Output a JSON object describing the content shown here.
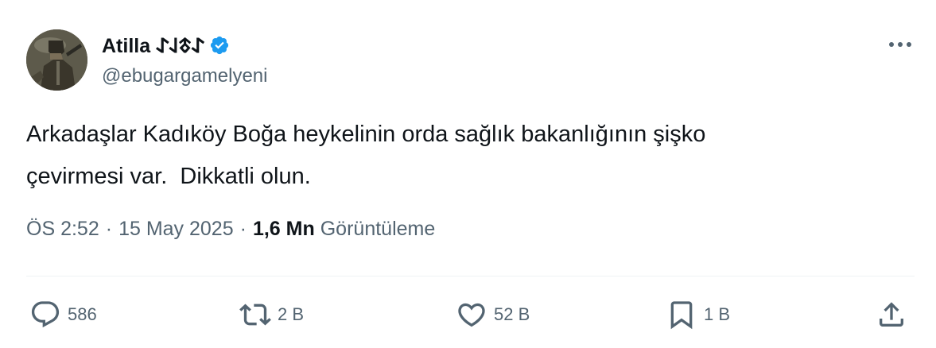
{
  "author": {
    "display_name": "Atilla 𐰀𐱃𐰞𐰀",
    "handle": "@ebugargamelyeni",
    "verified": true,
    "avatar_icon": "avatar-warrior-photo"
  },
  "tweet": {
    "text": "Arkadaşlar Kadıköy Boğa heykelinin orda sağlık bakanlığının şişko\nçevirmesi var.  Dikkatli olun."
  },
  "meta": {
    "time": "ÖS 2:52",
    "separator": "·",
    "date": "15 May 2025",
    "views_count": "1,6 Mn",
    "views_label": "Görüntüleme"
  },
  "actions": {
    "reply": {
      "icon": "reply-icon",
      "count": "586"
    },
    "retweet": {
      "icon": "retweet-icon",
      "count": "2 B"
    },
    "like": {
      "icon": "heart-icon",
      "count": "52 B"
    },
    "bookmark": {
      "icon": "bookmark-icon",
      "count": "1 B"
    },
    "share": {
      "icon": "share-icon"
    }
  },
  "colors": {
    "primary_text": "#0f1419",
    "secondary_text": "#536471",
    "verified_blue": "#1d9bf0",
    "divider": "#eff3f4"
  }
}
